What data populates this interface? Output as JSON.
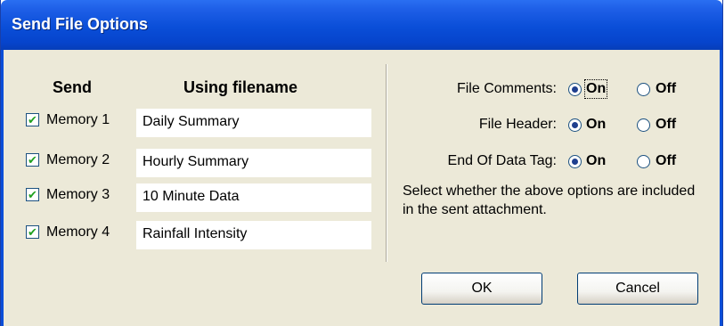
{
  "window": {
    "title": "Send File Options"
  },
  "columns": {
    "send": "Send",
    "filename": "Using filename"
  },
  "memories": [
    {
      "label": "Memory 1",
      "checked": true,
      "filename": "Daily Summary"
    },
    {
      "label": "Memory 2",
      "checked": true,
      "filename": "Hourly Summary"
    },
    {
      "label": "Memory 3",
      "checked": true,
      "filename": "10 Minute Data"
    },
    {
      "label": "Memory 4",
      "checked": true,
      "filename": "Rainfall Intensity"
    }
  ],
  "options": [
    {
      "label": "File Comments:",
      "on": "On",
      "off": "Off",
      "selected": "on"
    },
    {
      "label": "File Header:",
      "on": "On",
      "off": "Off",
      "selected": "on"
    },
    {
      "label": "End Of Data Tag:",
      "on": "On",
      "off": "Off",
      "selected": "on"
    }
  ],
  "note": "Select whether the above options are included in the sent attachment.",
  "buttons": {
    "ok": "OK",
    "cancel": "Cancel"
  },
  "colors": {
    "title_bar": "#0a4ed8",
    "dialog_bg": "#ece9d8",
    "check_mark": "#21a121"
  }
}
